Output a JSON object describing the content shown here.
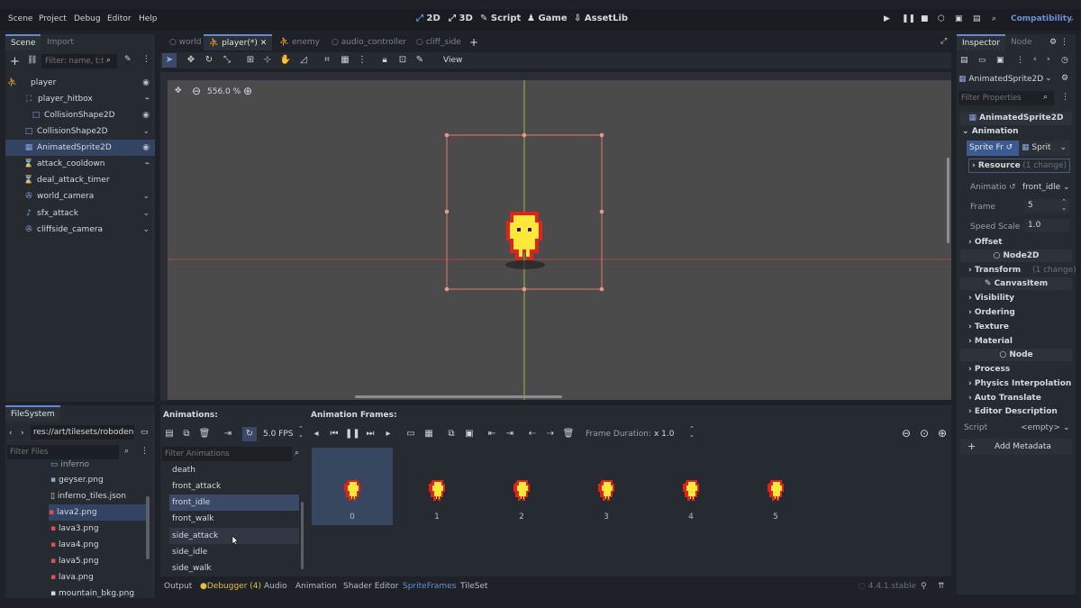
{
  "menu": {
    "items": [
      "Scene",
      "Project",
      "Debug",
      "Editor",
      "Help"
    ]
  },
  "workspaces": {
    "d2": "2D",
    "d3": "3D",
    "script": "Script",
    "game": "Game",
    "assetlib": "AssetLib"
  },
  "renderer": "Compatibility",
  "scene_dock": {
    "tabs": [
      "Scene",
      "Import"
    ],
    "filter_placeholder": "Filter: name, t:t"
  },
  "scene_tree": [
    {
      "label": "player"
    },
    {
      "label": "player_hitbox"
    },
    {
      "label": "CollisionShape2D"
    },
    {
      "label": "CollisionShape2D"
    },
    {
      "label": "AnimatedSprite2D"
    },
    {
      "label": "attack_cooldown"
    },
    {
      "label": "deal_attack_timer"
    },
    {
      "label": "world_camera"
    },
    {
      "label": "sfx_attack"
    },
    {
      "label": "cliffside_camera"
    }
  ],
  "editor_tabs": [
    "world",
    "player(*)",
    "enemy",
    "audio_controller",
    "cliff_side"
  ],
  "toolbar": {
    "view": "View"
  },
  "viewport": {
    "zoom": "556.0 %"
  },
  "filesystem": {
    "title": "FileSystem",
    "path": "res://art/tilesets/roboden-",
    "filter_placeholder": "Filter Files",
    "items": [
      "inferno",
      "geyser.png",
      "inferno_tiles.json",
      "lava2.png",
      "lava3.png",
      "lava4.png",
      "lava5.png",
      "lava.png",
      "mountain_bkg.png"
    ]
  },
  "animations": {
    "title": "Animations:",
    "fps": "5.0 FPS",
    "filter_placeholder": "Filter Animations",
    "items": [
      "death",
      "front_attack",
      "front_idle",
      "front_walk",
      "side_attack",
      "side_idle",
      "side_walk"
    ]
  },
  "frames": {
    "title": "Animation Frames:",
    "duration_label": "Frame Duration:",
    "duration_value": "x 1.0",
    "numbers": [
      "0",
      "1",
      "2",
      "3",
      "4",
      "5"
    ]
  },
  "bottom_tabs": {
    "output": "Output",
    "debugger": "Debugger (4)",
    "audio": "Audio",
    "animation": "Animation",
    "shader": "Shader Editor",
    "spriteframes": "SpriteFrames",
    "tileset": "TileSet"
  },
  "version": "4.4.1.stable",
  "inspector": {
    "tabs": [
      "Inspector",
      "Node"
    ],
    "node_name": "AnimatedSprite2D",
    "filter_placeholder": "Filter Properties",
    "class_title": "AnimatedSprite2D",
    "animation_section": "Animation",
    "sprite_frames_label": "Sprite Fr",
    "sprite_frames_val": "Sprit",
    "resource": "Resource",
    "resource_changes": "(1 change)",
    "animation_label": "Animatio",
    "animation_val": "front_idle",
    "frame_label": "Frame",
    "frame_val": "5",
    "speed_label": "Speed Scale",
    "speed_val": "1.0",
    "offset": "Offset",
    "node2d": "Node2D",
    "transform": "Transform",
    "transform_changes": "(1 change)",
    "canvasitem": "CanvasItem",
    "visibility": "Visibility",
    "ordering": "Ordering",
    "texture": "Texture",
    "material": "Material",
    "node": "Node",
    "process": "Process",
    "physics": "Physics Interpolation",
    "auto_translate": "Auto Translate",
    "editor_desc": "Editor Description",
    "script_label": "Script",
    "script_val": "<empty>",
    "add_metadata": "Add Metadata"
  },
  "colors": {
    "accent": "#5e8ad6",
    "selection": "#324363",
    "selection_box": "#e07a6a",
    "sprite_yellow": "#ffe83a",
    "sprite_red": "#e0221a"
  }
}
